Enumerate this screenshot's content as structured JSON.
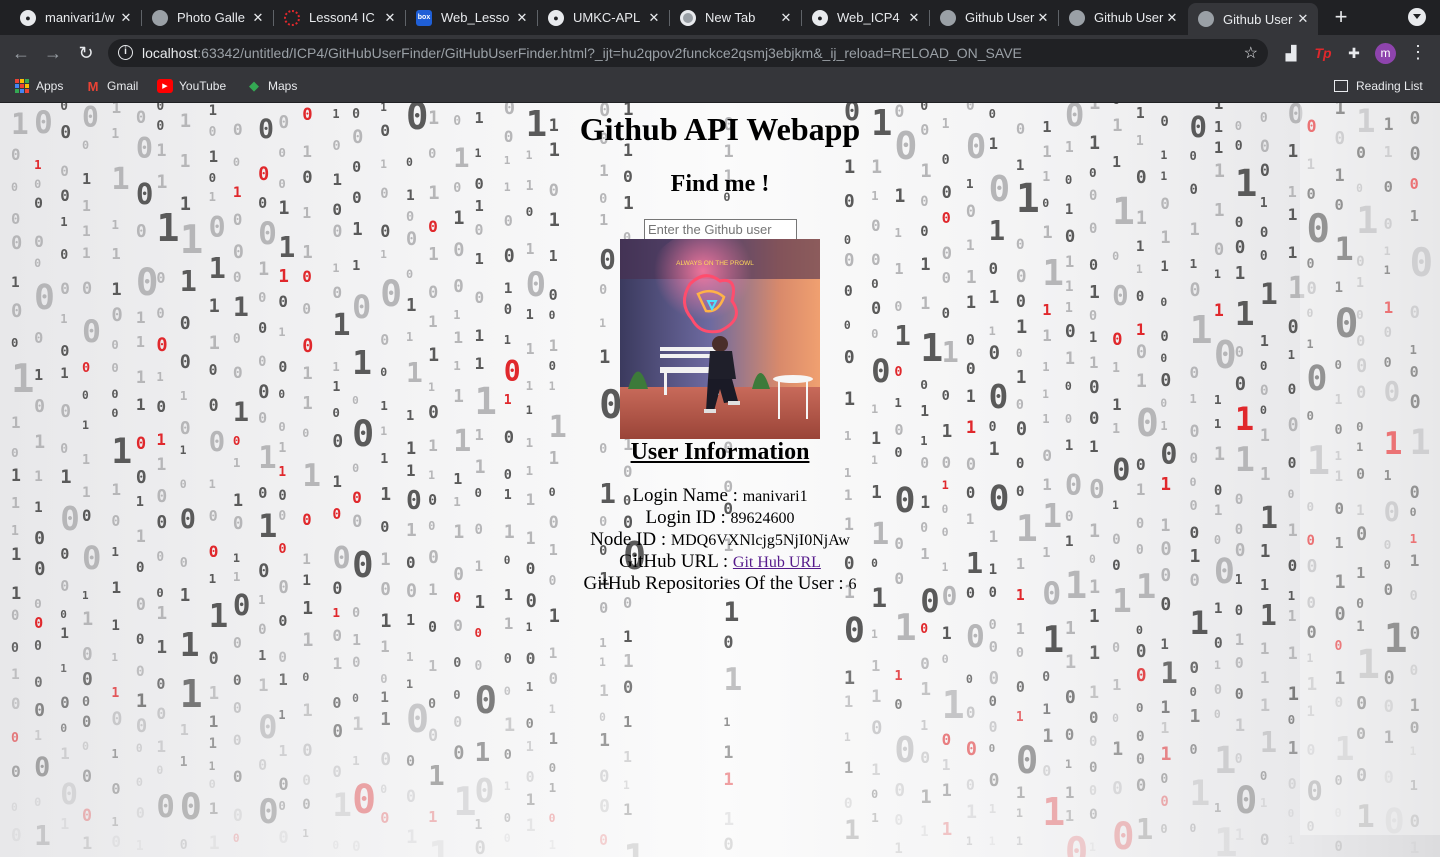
{
  "browser": {
    "tabs": [
      {
        "title": "manivari1/w",
        "icon": "github-icon",
        "active": false
      },
      {
        "title": "Photo Galle",
        "icon": "globe-icon",
        "active": false
      },
      {
        "title": "Lesson4 IC",
        "icon": "loading-icon",
        "active": false
      },
      {
        "title": "Web_Lesso",
        "icon": "box-icon",
        "active": false
      },
      {
        "title": "UMKC-APL",
        "icon": "github-icon",
        "active": false
      },
      {
        "title": "New Tab",
        "icon": "chrome-icon",
        "active": false
      },
      {
        "title": "Web_ICP4",
        "icon": "github-icon",
        "active": false
      },
      {
        "title": "Github User",
        "icon": "globe-icon",
        "active": false
      },
      {
        "title": "Github User",
        "icon": "globe-icon",
        "active": false
      },
      {
        "title": "Github User",
        "icon": "globe-icon",
        "active": true
      }
    ],
    "url_host": "localhost",
    "url_rest": ":63342/untitled/ICP4/GitHubUserFinder/GitHubUserFinder.html?_ijt=hu2qpov2funckce2qsmj3ebjkm&_ij_reload=RELOAD_ON_SAVE",
    "profile_initial": "m",
    "bookmarks": [
      {
        "label": "Apps",
        "icon": "apps-grid-icon"
      },
      {
        "label": "Gmail",
        "icon": "gmail-icon"
      },
      {
        "label": "YouTube",
        "icon": "youtube-icon"
      },
      {
        "label": "Maps",
        "icon": "maps-icon"
      }
    ],
    "reading_list": "Reading List"
  },
  "page": {
    "title": "Github API Webapp",
    "subtitle": "Find me !",
    "search_placeholder": "Enter the Github user",
    "info_heading": "User Information",
    "login_name_label": "Login Name : ",
    "login_name": "manivari1",
    "login_id_label": "Login ID : ",
    "login_id": "89624600",
    "node_id_label": "Node ID : ",
    "node_id": "MDQ6VXNlcjg5NjI0NjAw",
    "github_url_label": "GitHub URL : ",
    "github_url_text": "Git Hub URL",
    "repos_label": "GitHub Repositories Of the User : ",
    "repos_count": "6",
    "avatar_sign": "ALWAYS ON THE PROWL"
  },
  "colors": {
    "accent_red": "#e0282c",
    "link": "#551a8b"
  }
}
